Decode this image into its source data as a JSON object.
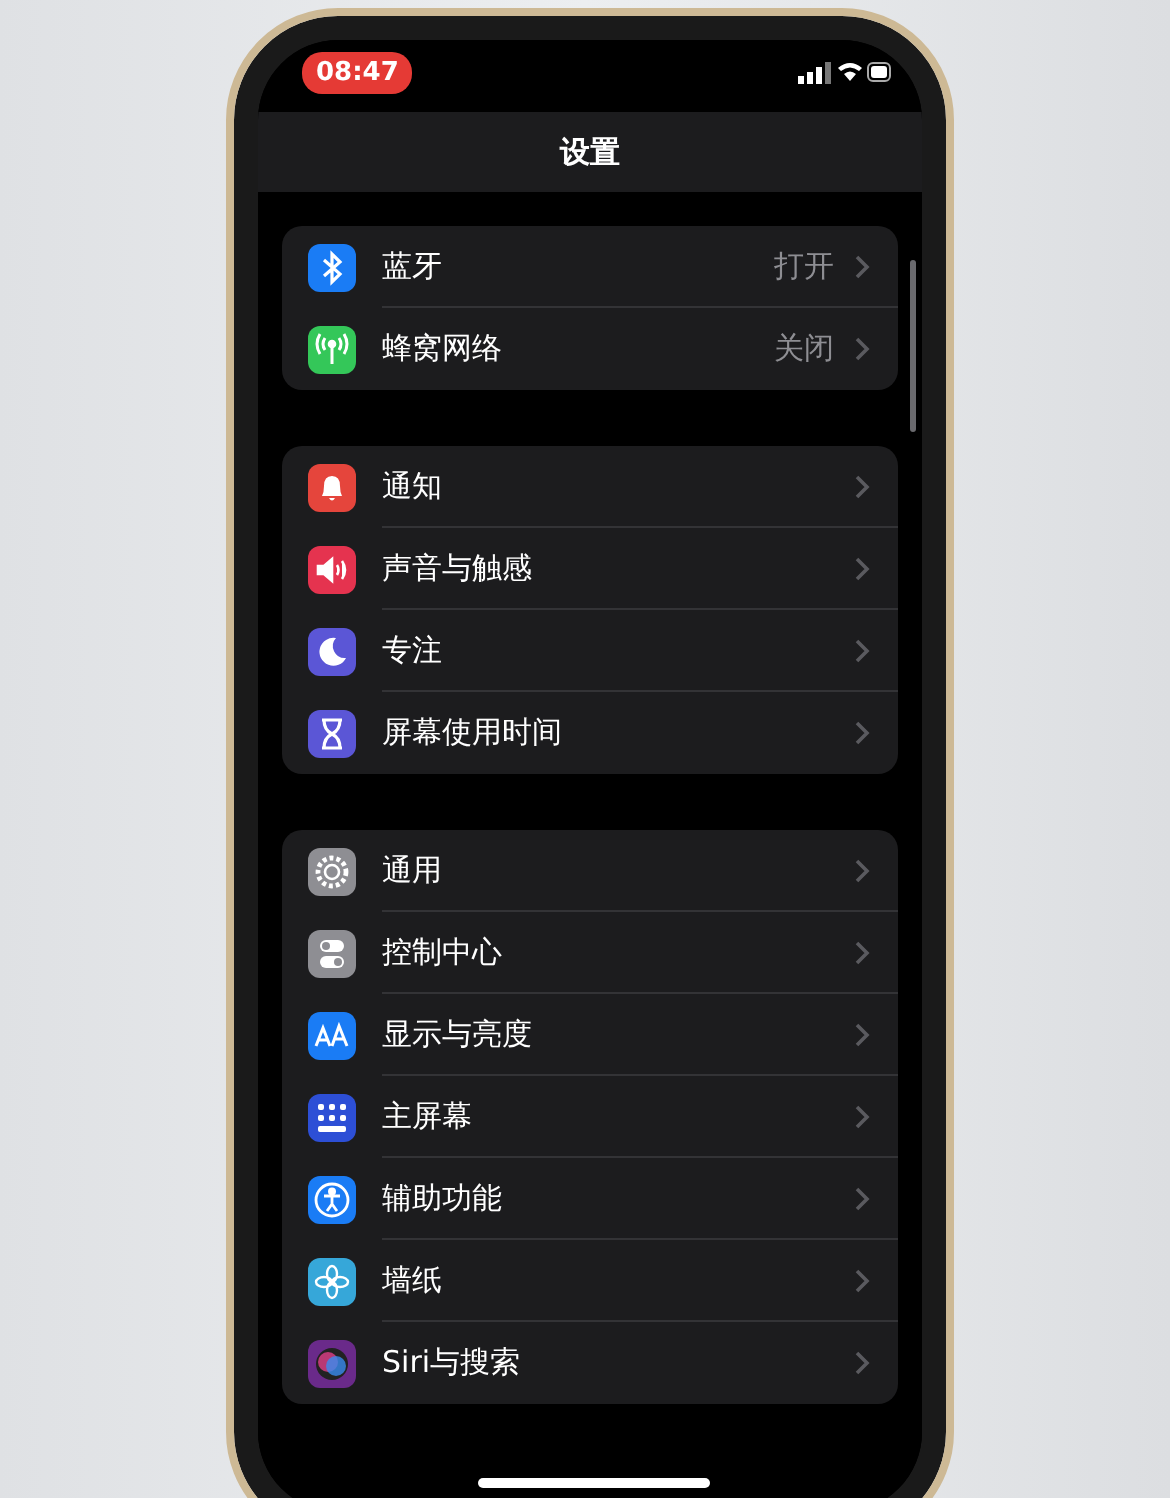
{
  "status_bar": {
    "time": "08:47"
  },
  "title": "设置",
  "sections": [
    {
      "items": [
        {
          "kind": "bluetooth",
          "color": "#1a7cf5",
          "label": "蓝牙",
          "value": "打开"
        },
        {
          "kind": "cellular",
          "color": "#34c759",
          "label": "蜂窝网络",
          "value": "关闭"
        }
      ]
    },
    {
      "items": [
        {
          "kind": "bell",
          "color": "#e5453c",
          "label": "通知"
        },
        {
          "kind": "speaker",
          "color": "#e5334f",
          "label": "声音与触感"
        },
        {
          "kind": "moon",
          "color": "#5b56d6",
          "label": "专注"
        },
        {
          "kind": "hourglass",
          "color": "#5b56d6",
          "label": "屏幕使用时间"
        }
      ]
    },
    {
      "items": [
        {
          "kind": "gear",
          "color": "#8e8e93",
          "label": "通用"
        },
        {
          "kind": "toggles",
          "color": "#8e8e93",
          "label": "控制中心"
        },
        {
          "kind": "letters",
          "color": "#1a7cf5",
          "label": "显示与亮度"
        },
        {
          "kind": "grid",
          "color": "#2d4fd6",
          "label": "主屏幕"
        },
        {
          "kind": "person",
          "color": "#1a7cf5",
          "label": "辅助功能"
        },
        {
          "kind": "flower",
          "color": "#36a7d9",
          "label": "墙纸"
        },
        {
          "kind": "orb",
          "color": "#6a2a8a",
          "label": "Siri与搜索"
        }
      ]
    }
  ]
}
